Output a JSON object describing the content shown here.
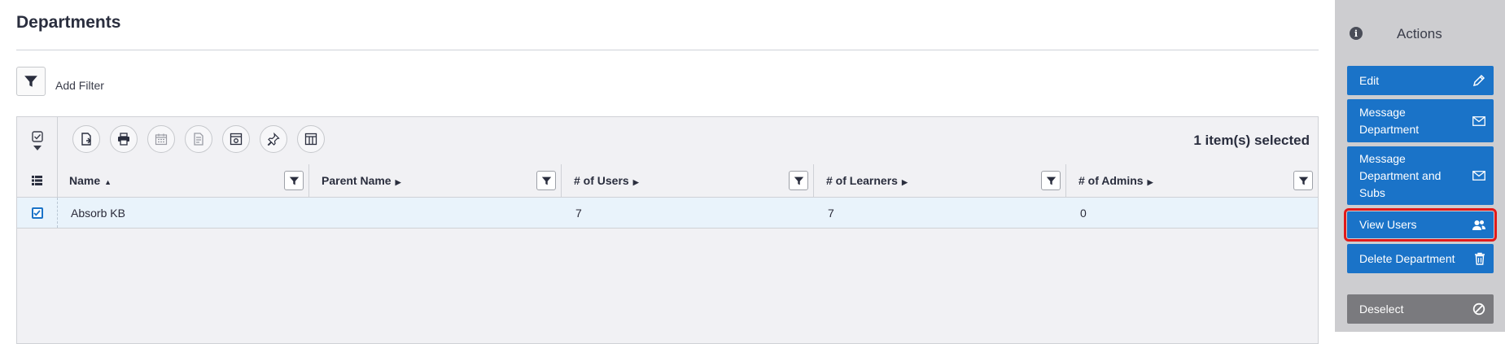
{
  "page": {
    "title": "Departments"
  },
  "filter": {
    "add_filter_label": "Add Filter"
  },
  "toolbar": {
    "selected_count": "1 item(s) selected",
    "buttons": [
      {
        "icon": "export-icon",
        "enabled": true
      },
      {
        "icon": "print-icon",
        "enabled": true
      },
      {
        "icon": "calendar-icon",
        "enabled": false
      },
      {
        "icon": "report-icon",
        "enabled": false
      },
      {
        "icon": "settings-window-icon",
        "enabled": true
      },
      {
        "icon": "pin-icon",
        "enabled": true
      },
      {
        "icon": "columns-icon",
        "enabled": true
      }
    ]
  },
  "table": {
    "columns": [
      {
        "label": "Name",
        "sort": "▲"
      },
      {
        "label": "Parent Name",
        "sort": "▶"
      },
      {
        "label": "# of Users",
        "sort": "▶"
      },
      {
        "label": "# of Learners",
        "sort": "▶"
      },
      {
        "label": "# of Admins",
        "sort": "▶"
      }
    ],
    "rows": [
      {
        "selected": true,
        "cells": [
          "Absorb KB",
          "",
          "7",
          "7",
          "0"
        ]
      }
    ]
  },
  "sidebar": {
    "title": "Actions",
    "actions": [
      {
        "label": "Edit",
        "icon": "pencil-icon"
      },
      {
        "label": "Message Department",
        "icon": "envelope-icon"
      },
      {
        "label": "Message Department and Subs",
        "icon": "envelope-icon"
      },
      {
        "label": "View Users",
        "icon": "users-icon",
        "highlighted": true
      },
      {
        "label": "Delete Department",
        "icon": "trash-icon"
      },
      {
        "label": "Deselect",
        "icon": "ban-icon"
      }
    ]
  },
  "colors": {
    "accent": "#1a73c8",
    "highlight": "#e11a1a",
    "sidebar_bg": "#cdcdd0",
    "selected_row": "#e9f3fb"
  }
}
